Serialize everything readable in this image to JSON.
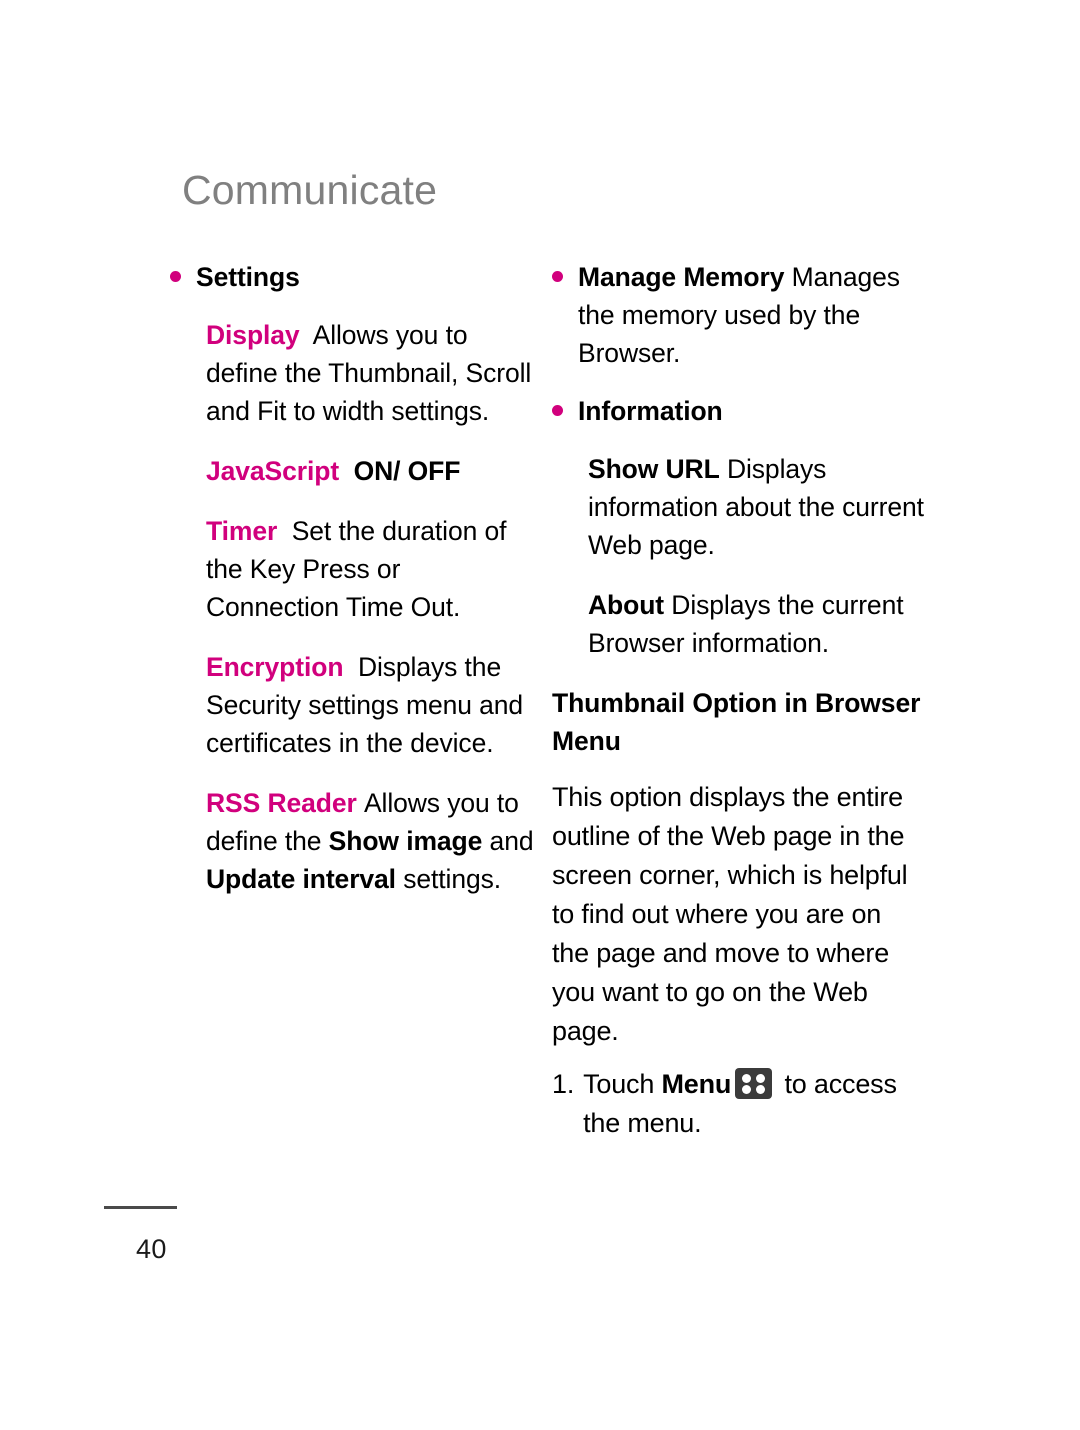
{
  "document": {
    "chapter_title": "Communicate",
    "page_number": "40"
  },
  "left_column": {
    "settings_bullet": "Settings",
    "display": {
      "term": "Display",
      "text": "Allows you to define the Thumbnail, Scroll and Fit to width settings."
    },
    "javascript": {
      "term": "JavaScript",
      "text": "ON/ OFF"
    },
    "timer": {
      "term": "Timer",
      "text": "Set the duration of the Key Press or Connection Time Out."
    },
    "encryption": {
      "term": "Encryption",
      "text": "Displays the Security settings menu and certificates in the device."
    },
    "rss_reader": {
      "term": "RSS Reader",
      "text_1": "Allows you to define the ",
      "bold_1": "Show image",
      "text_2": " and ",
      "bold_2": "Update interval",
      "text_3": " settings."
    }
  },
  "right_column": {
    "manage_memory": {
      "lead": "Manage Memory",
      "text": " Manages the memory used by the Browser."
    },
    "information_bullet": "Information",
    "show_url": {
      "term": "Show URL",
      "text": "Displays information about the current Web page."
    },
    "about": {
      "term": "About",
      "text": "Displays the current Browser information."
    },
    "thumbnail_section": {
      "heading": "Thumbnail Option in Browser Menu",
      "body": "This option displays the entire outline of the Web page in the screen corner, which is helpful to find out where you are on the page and move to where you want to go on the Web page."
    },
    "step_1": {
      "number": "1.",
      "text_before": "Touch ",
      "bold_label": "Menu",
      "icon": "menu-grid-icon",
      "text_after": " to access the menu."
    }
  },
  "colors": {
    "accent_magenta": "#d1007d",
    "title_gray": "#808080",
    "body_black": "#000000",
    "icon_dark": "#3b3b3b"
  }
}
